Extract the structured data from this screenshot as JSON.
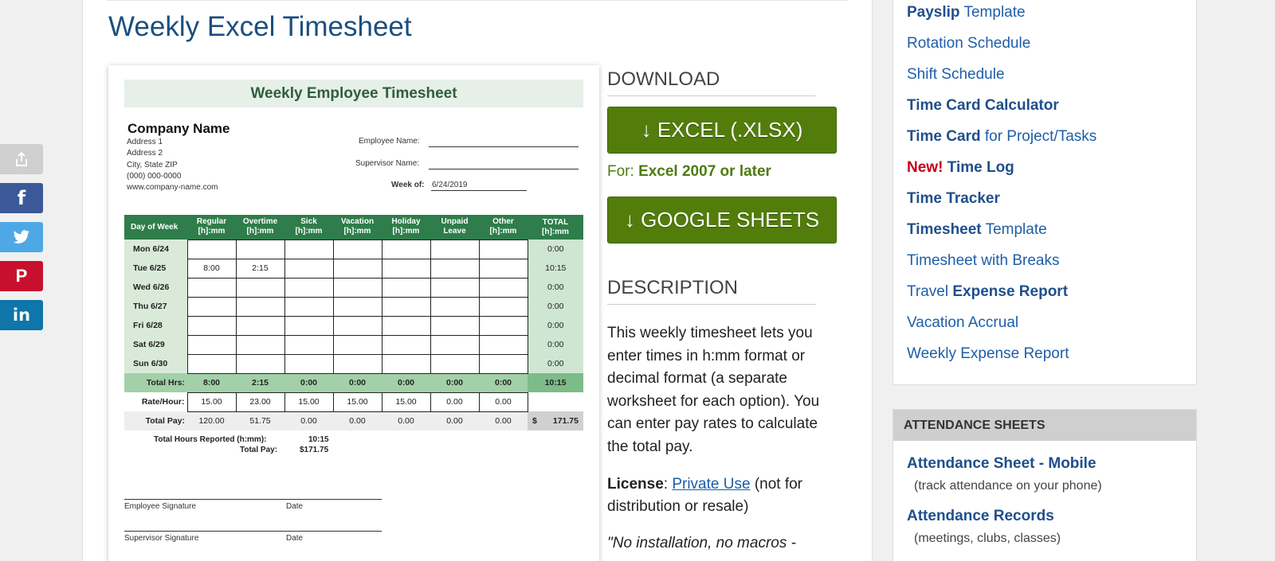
{
  "share": [
    "share-icon",
    "facebook-icon",
    "twitter-icon",
    "pinterest-icon",
    "linkedin-icon"
  ],
  "colors": {
    "accent": "#1b4f7f",
    "download_green": "#527d0b",
    "sheet_green": "#2e7d4a"
  },
  "page_title": "Weekly Excel Timesheet",
  "sheet": {
    "title": "Weekly Employee Timesheet",
    "company_name": "Company Name",
    "address": [
      "Address 1",
      "Address 2",
      "City, State  ZIP",
      "(000) 000-0000",
      "www.company-name.com"
    ],
    "employee_label": "Employee Name:",
    "supervisor_label": "Supervisor Name:",
    "week_label": "Week of:",
    "week_value": "6/24/2019",
    "headers": [
      "Day of Week",
      "Regular\n[h]:mm",
      "Overtime\n[h]:mm",
      "Sick\n[h]:mm",
      "Vacation\n[h]:mm",
      "Holiday\n[h]:mm",
      "Unpaid\nLeave",
      "Other\n[h]:mm",
      "TOTAL\n[h]:mm"
    ],
    "rows": [
      {
        "day": "Mon 6/24",
        "cells": [
          "",
          "",
          "",
          "",
          "",
          "",
          ""
        ],
        "total": "0:00"
      },
      {
        "day": "Tue 6/25",
        "cells": [
          "8:00",
          "2:15",
          "",
          "",
          "",
          "",
          ""
        ],
        "total": "10:15"
      },
      {
        "day": "Wed 6/26",
        "cells": [
          "",
          "",
          "",
          "",
          "",
          "",
          ""
        ],
        "total": "0:00"
      },
      {
        "day": "Thu 6/27",
        "cells": [
          "",
          "",
          "",
          "",
          "",
          "",
          ""
        ],
        "total": "0:00"
      },
      {
        "day": "Fri 6/28",
        "cells": [
          "",
          "",
          "",
          "",
          "",
          "",
          ""
        ],
        "total": "0:00"
      },
      {
        "day": "Sat 6/29",
        "cells": [
          "",
          "",
          "",
          "",
          "",
          "",
          ""
        ],
        "total": "0:00"
      },
      {
        "day": "Sun 6/30",
        "cells": [
          "",
          "",
          "",
          "",
          "",
          "",
          ""
        ],
        "total": "0:00"
      }
    ],
    "total_hrs": {
      "label": "Total Hrs:",
      "cells": [
        "8:00",
        "2:15",
        "0:00",
        "0:00",
        "0:00",
        "0:00",
        "0:00"
      ],
      "total": "10:15"
    },
    "rate": {
      "label": "Rate/Hour:",
      "cells": [
        "15.00",
        "23.00",
        "15.00",
        "15.00",
        "15.00",
        "0.00",
        "0.00"
      ]
    },
    "total_pay": {
      "label": "Total Pay:",
      "cells": [
        "120.00",
        "51.75",
        "0.00",
        "0.00",
        "0.00",
        "0.00",
        "0.00"
      ],
      "currency": "$",
      "total": "171.75"
    },
    "summary": {
      "hours_label": "Total Hours Reported (h:mm):",
      "hours_value": "10:15",
      "pay_label": "Total Pay:",
      "pay_value": "$171.75"
    },
    "sig_employee": "Employee Signature",
    "sig_supervisor": "Supervisor Signature",
    "sig_date": "Date"
  },
  "download": {
    "heading": "DOWNLOAD",
    "excel_button": "↓ EXCEL (.XLSX)",
    "for_label": "For:",
    "for_value": "Excel 2007 or later",
    "sheets_button": "↓ GOOGLE SHEETS"
  },
  "description": {
    "heading": "DESCRIPTION",
    "text": "This weekly timesheet lets you enter times in h:mm format or decimal format (a separate worksheet for each option). You can enter pay rates to calculate the total pay.",
    "license_label": "License",
    "license_link": "Private Use",
    "license_note": "(not for distribution or resale)",
    "quote": "\"No installation, no macros -"
  },
  "sidebar": {
    "items": [
      {
        "bold": "Payslip",
        "rest": " Template"
      },
      {
        "bold": "",
        "rest": "Rotation Schedule"
      },
      {
        "bold": "",
        "rest": "Shift Schedule"
      },
      {
        "bold": "Time Card Calculator",
        "rest": ""
      },
      {
        "bold": "Time Card",
        "rest": " for Project/Tasks"
      },
      {
        "new": "New!",
        "bold": " Time Log",
        "rest": ""
      },
      {
        "bold": "Time Tracker",
        "rest": ""
      },
      {
        "bold": "Timesheet",
        "rest": " Template"
      },
      {
        "bold": "",
        "rest": "Timesheet with Breaks"
      },
      {
        "pre": "Travel ",
        "bold": "Expense Report",
        "rest": ""
      },
      {
        "bold": "",
        "rest": "Vacation Accrual"
      },
      {
        "bold": "",
        "rest": "Weekly Expense Report"
      }
    ],
    "attendance": {
      "heading": "ATTENDANCE SHEETS",
      "links": [
        {
          "title": "Attendance Sheet - Mobile",
          "sub": "(track attendance on your phone)"
        },
        {
          "title": "Attendance Records",
          "sub": "(meetings, clubs, classes)"
        }
      ]
    }
  }
}
